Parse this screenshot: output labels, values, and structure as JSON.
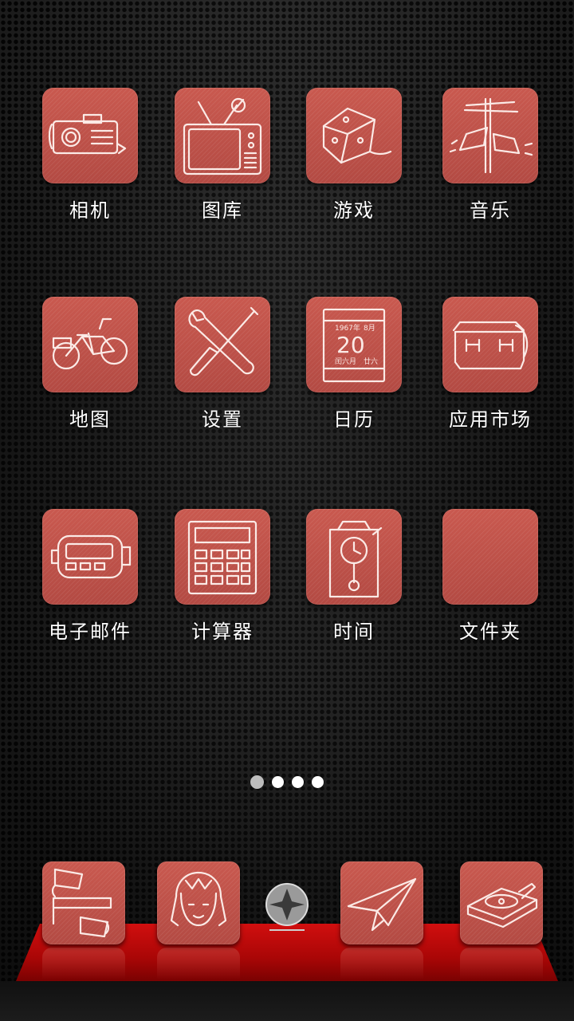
{
  "home_screen": {
    "apps": [
      {
        "label": "相机",
        "icon": "camera-icon"
      },
      {
        "label": "图库",
        "icon": "tv-gallery-icon"
      },
      {
        "label": "游戏",
        "icon": "dice-icon"
      },
      {
        "label": "音乐",
        "icon": "loudspeaker-icon"
      },
      {
        "label": "地图",
        "icon": "bicycle-icon"
      },
      {
        "label": "设置",
        "icon": "wrench-screwdriver-icon"
      },
      {
        "label": "日历",
        "icon": "calendar-icon"
      },
      {
        "label": "应用市场",
        "icon": "bag-icon"
      },
      {
        "label": "电子邮件",
        "icon": "pager-icon"
      },
      {
        "label": "计算器",
        "icon": "calculator-icon"
      },
      {
        "label": "时间",
        "icon": "pendulum-clock-icon"
      },
      {
        "label": "文件夹",
        "icon": "folder-icon"
      }
    ],
    "calendar_icon_text": {
      "year": "1967年",
      "month": "8月",
      "day": "20",
      "lunar_month": "闰六月",
      "lunar_day": "廿六"
    }
  },
  "page_indicator": {
    "total": 4,
    "current": 1
  },
  "dock": {
    "apps": [
      {
        "icon": "phone-handset-icon"
      },
      {
        "icon": "contacts-girl-icon"
      },
      {
        "icon": "app-drawer-icon"
      },
      {
        "icon": "paper-plane-icon"
      },
      {
        "icon": "record-player-icon"
      }
    ]
  },
  "colors": {
    "tile": "#c0524a",
    "shelf": "#c10a0a",
    "label": "#ffffff"
  }
}
